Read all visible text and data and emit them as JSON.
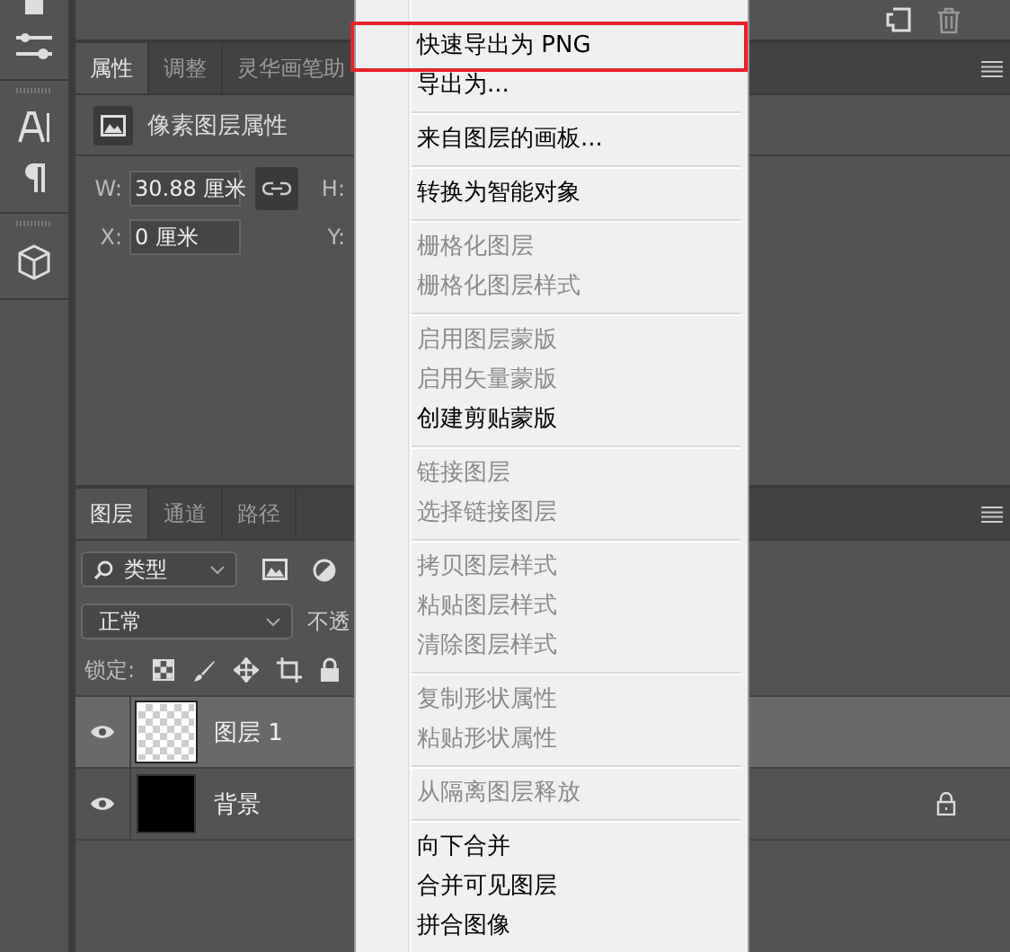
{
  "properties_panel": {
    "tabs": [
      {
        "label": "属性",
        "selected": true
      },
      {
        "label": "调整",
        "selected": false
      },
      {
        "label": "灵华画笔助",
        "selected": false
      }
    ],
    "header": "像素图层属性",
    "fields": [
      {
        "label": "W:",
        "value": "30.88 厘米",
        "right_label": "H:",
        "linked": true
      },
      {
        "label": "X:",
        "value": "0 厘米",
        "right_label": "Y:",
        "linked": false
      }
    ]
  },
  "layers_panel": {
    "tabs": [
      {
        "label": "图层",
        "selected": true
      },
      {
        "label": "通道",
        "selected": false
      },
      {
        "label": "路径",
        "selected": false
      }
    ],
    "filter": "类型",
    "blend_mode": "正常",
    "opacity_label": "不透",
    "lock_label": "锁定:",
    "layers": [
      {
        "name": "图层 1",
        "selected": true,
        "visible": true,
        "locked": false,
        "kind": "transparent"
      },
      {
        "name": "背景",
        "selected": false,
        "visible": true,
        "locked": true,
        "kind": "black"
      }
    ]
  },
  "context_menu": {
    "groups": [
      {
        "items": [
          {
            "label": "快速导出为 PNG",
            "disabled": false,
            "highlighted": true
          },
          {
            "label": "导出为...",
            "disabled": false,
            "highlighted": false
          }
        ]
      },
      {
        "items": [
          {
            "label": "来自图层的画板...",
            "disabled": false,
            "highlighted": false
          }
        ]
      },
      {
        "items": [
          {
            "label": "转换为智能对象",
            "disabled": false,
            "highlighted": false
          }
        ]
      },
      {
        "items": [
          {
            "label": "栅格化图层",
            "disabled": true,
            "highlighted": false
          },
          {
            "label": "栅格化图层样式",
            "disabled": true,
            "highlighted": false
          }
        ]
      },
      {
        "items": [
          {
            "label": "启用图层蒙版",
            "disabled": true,
            "highlighted": false
          },
          {
            "label": "启用矢量蒙版",
            "disabled": true,
            "highlighted": false
          },
          {
            "label": "创建剪贴蒙版",
            "disabled": false,
            "highlighted": false
          }
        ]
      },
      {
        "items": [
          {
            "label": "链接图层",
            "disabled": true,
            "highlighted": false
          },
          {
            "label": "选择链接图层",
            "disabled": true,
            "highlighted": false
          }
        ]
      },
      {
        "items": [
          {
            "label": "拷贝图层样式",
            "disabled": true,
            "highlighted": false
          },
          {
            "label": "粘贴图层样式",
            "disabled": true,
            "highlighted": false
          },
          {
            "label": "清除图层样式",
            "disabled": true,
            "highlighted": false
          }
        ]
      },
      {
        "items": [
          {
            "label": "复制形状属性",
            "disabled": true,
            "highlighted": false
          },
          {
            "label": "粘贴形状属性",
            "disabled": true,
            "highlighted": false
          }
        ]
      },
      {
        "items": [
          {
            "label": "从隔离图层释放",
            "disabled": true,
            "highlighted": false
          }
        ]
      },
      {
        "items": [
          {
            "label": "向下合并",
            "disabled": false,
            "highlighted": false
          },
          {
            "label": "合并可见图层",
            "disabled": false,
            "highlighted": false
          },
          {
            "label": "拼合图像",
            "disabled": false,
            "highlighted": false
          }
        ]
      }
    ]
  }
}
